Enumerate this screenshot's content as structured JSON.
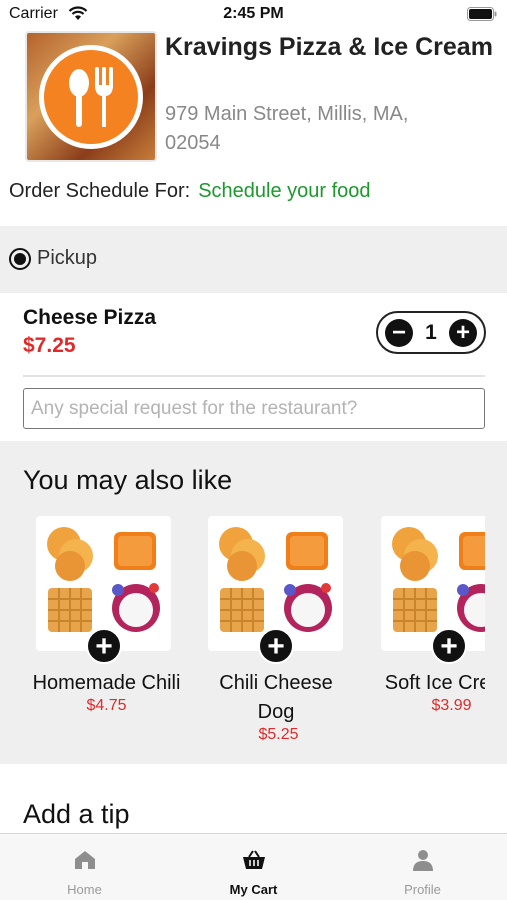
{
  "status_bar": {
    "carrier": "Carrier",
    "time": "2:45 PM"
  },
  "restaurant": {
    "name": "Kravings Pizza & Ice Cream",
    "address": "979 Main Street, Millis, MA, 02054",
    "logo_icon": "fork-spoon-icon",
    "brand_color": "#f58220"
  },
  "schedule": {
    "label": "Order Schedule For:",
    "link": "Schedule your food",
    "link_color": "#1a9a2a"
  },
  "order_type": {
    "selected": "Pickup"
  },
  "cart_item": {
    "name": "Cheese Pizza",
    "price": "$7.25",
    "quantity": "1",
    "minus": "−",
    "plus": "+"
  },
  "special_request": {
    "value": "",
    "placeholder": "Any special request for the restaurant?"
  },
  "suggestions": {
    "title": "You may also like",
    "items": [
      {
        "name": "Homemade Chili",
        "price": "$4.75"
      },
      {
        "name": "Chili Cheese Dog",
        "price": "$5.25"
      },
      {
        "name": "Soft Ice Cream",
        "price": "$3.99"
      }
    ],
    "add_symbol": "+"
  },
  "tip": {
    "title": "Add a tip"
  },
  "tab_bar": {
    "tabs": [
      {
        "label": "Home",
        "icon": "home-icon"
      },
      {
        "label": "My Cart",
        "icon": "basket-icon",
        "active": true
      },
      {
        "label": "Profile",
        "icon": "person-icon"
      }
    ]
  },
  "colors": {
    "price": "#e02a2a",
    "section_bg": "#efefef"
  }
}
